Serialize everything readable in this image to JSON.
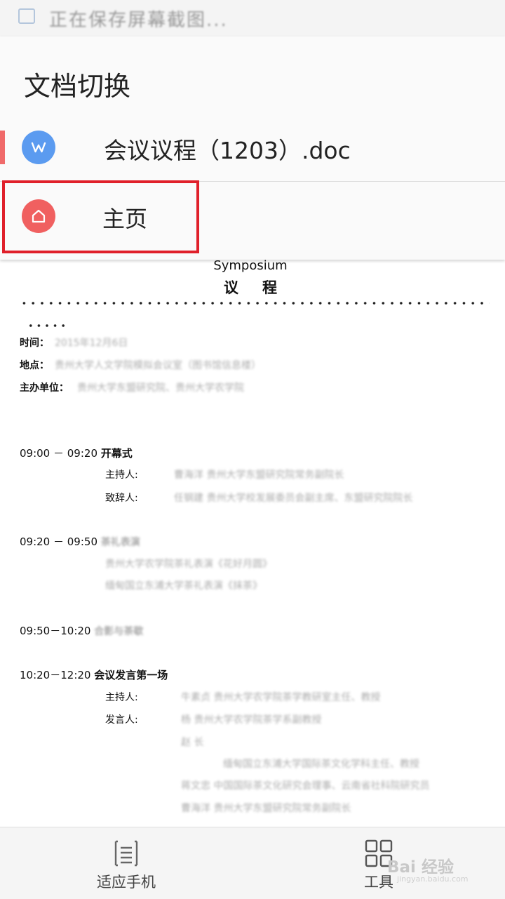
{
  "status_bar": {
    "text": "正在保存屏幕截图..."
  },
  "switcher": {
    "title": "文档切换",
    "documents": [
      {
        "label": "会议议程（1203）.doc"
      }
    ],
    "home_label": "主页"
  },
  "document": {
    "heading_en": "Symposium",
    "heading_cn": "议程",
    "info": [
      {
        "label": "时间：",
        "value": "2015年12月6日"
      },
      {
        "label": "地点：",
        "value": "贵州大学人文学院模拟会议室（图书馆信息楼）"
      },
      {
        "label": "主办单位：",
        "value": "贵州大学东盟研究院、贵州大学农学院"
      }
    ],
    "slots": [
      {
        "time": "09:00 － 09:20",
        "title": "开幕式"
      },
      {
        "time": "09:20 － 09:50",
        "title": "茶礼表演"
      },
      {
        "time": "09:50－10:20",
        "title": "合影与茶歇"
      },
      {
        "time": "10:20－12:20",
        "title": "会议发言第一场"
      }
    ],
    "roles": {
      "host": "主持人:",
      "speech": "致辞人:",
      "host2": "主持人:",
      "speakers": "发言人:"
    },
    "blurred": {
      "host1": "曹海洋 贵州大学东盟研究院常务副院长",
      "speech1": "任钢建 贵州大学校发展委员会副主席、东盟研究院院长",
      "perf1": "贵州大学农学院茶礼表演《花好月圆》",
      "perf2": "缅甸国立东浦大学茶礼表演《抹茶》",
      "host2": "牛素贞 贵州大学农学院茶学教研室主任、教授",
      "sp1": "杨 贵州大学农学院茶学系副教授",
      "sp2": "赵 长",
      "sp3": "缅甸国立东浦大学国际茶文化学科主任、教授",
      "sp4": "蒋文忠 中国国际茶文化研究会理事、云南省社科院研究员",
      "sp5": "曹海洋 贵州大学东盟研究院常务副院长"
    }
  },
  "bottom_bar": {
    "fit_label": "适应手机",
    "tools_label": "工具"
  },
  "watermark": {
    "text": "Bai 经验",
    "sub": "jingyan.baidu.com"
  },
  "colors": {
    "doc_icon": "#5b9bf0",
    "home_icon": "#f06060",
    "active_indicator": "#f06a6a",
    "highlight": "#e0202a"
  }
}
